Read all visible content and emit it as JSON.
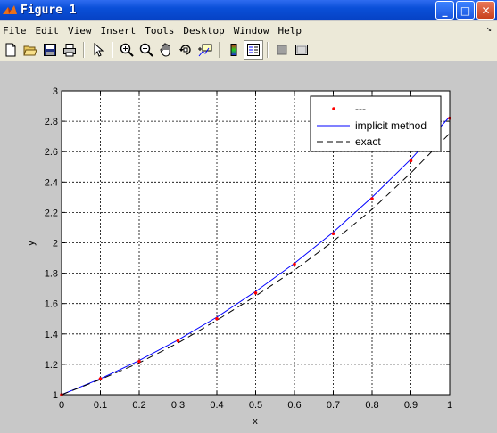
{
  "window": {
    "title": "Figure 1"
  },
  "titlebar_buttons": {
    "minimize": "_",
    "maximize": "□",
    "close": "✕"
  },
  "menu": [
    "File",
    "Edit",
    "View",
    "Insert",
    "Tools",
    "Desktop",
    "Window",
    "Help"
  ],
  "menu_arrow": "↘",
  "toolbar": [
    "new-figure-icon",
    "open-file-icon",
    "save-icon",
    "print-icon",
    "edit-plot-arrow-icon",
    "zoom-in-icon",
    "zoom-out-icon",
    "pan-hand-icon",
    "rotate-3d-icon",
    "data-cursor-icon",
    "colorbar-icon",
    "legend-icon",
    "hide-plot-tools-icon",
    "show-plot-tools-icon"
  ],
  "colors": {
    "implicit": "#0000ff",
    "exact": "#000000",
    "marker": "#ff0000"
  },
  "chart_data": {
    "type": "line",
    "xlabel": "x",
    "ylabel": "y",
    "xlim": [
      0,
      1
    ],
    "ylim": [
      1,
      3
    ],
    "xticks": [
      "0",
      "0.1",
      "0.2",
      "0.3",
      "0.4",
      "0.5",
      "0.6",
      "0.7",
      "0.8",
      "0.9",
      "1"
    ],
    "yticks": [
      "1",
      "1.2",
      "1.4",
      "1.6",
      "1.8",
      "2",
      "2.2",
      "2.4",
      "2.6",
      "2.8",
      "3"
    ],
    "grid": true,
    "legend_position": "top-right",
    "x": [
      0,
      0.1,
      0.2,
      0.3,
      0.4,
      0.5,
      0.6,
      0.7,
      0.8,
      0.9,
      1.0
    ],
    "series": [
      {
        "name": "---",
        "style": "red-dots",
        "values": [
          1.0,
          1.105,
          1.22,
          1.355,
          1.5,
          1.67,
          1.86,
          2.06,
          2.29,
          2.54,
          2.82
        ]
      },
      {
        "name": "implicit method",
        "style": "solid-blue",
        "values": [
          1.0,
          1.105,
          1.225,
          1.36,
          1.51,
          1.68,
          1.865,
          2.07,
          2.3,
          2.55,
          2.83
        ]
      },
      {
        "name": "exact",
        "style": "dashed-black",
        "values": [
          1.0,
          1.1,
          1.21,
          1.34,
          1.49,
          1.65,
          1.82,
          2.01,
          2.22,
          2.46,
          2.72
        ]
      }
    ]
  }
}
